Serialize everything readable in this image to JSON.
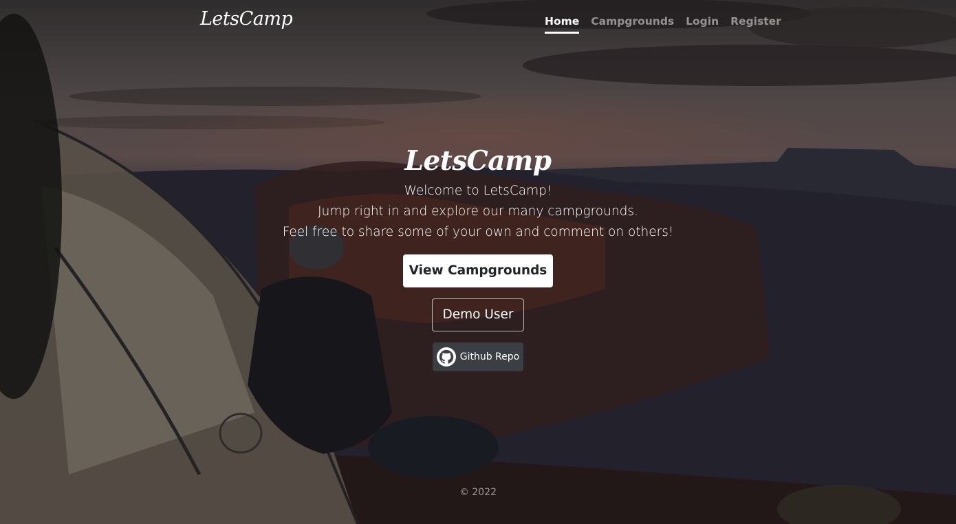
{
  "nav": {
    "brand": "LetsCamp",
    "links": [
      {
        "label": "Home",
        "active": true
      },
      {
        "label": "Campgrounds",
        "active": false
      },
      {
        "label": "Login",
        "active": false
      },
      {
        "label": "Register",
        "active": false
      }
    ]
  },
  "hero": {
    "title": "LetsCamp",
    "lines": [
      "Welcome to LetsCamp!",
      "Jump right in and explore our many campgrounds.",
      "Feel free to share some of your own and comment on others!"
    ],
    "view_button": "View Campgrounds",
    "demo_button": "Demo User",
    "github_button": "Github Repo",
    "github_icon": "github-icon"
  },
  "footer": {
    "copyright": "© 2022"
  },
  "colors": {
    "primary_text": "#ffffff",
    "muted_nav": "rgba(255,255,255,0.5)",
    "button_bg": "#ffffff",
    "github_bg": "#3b3f44"
  }
}
